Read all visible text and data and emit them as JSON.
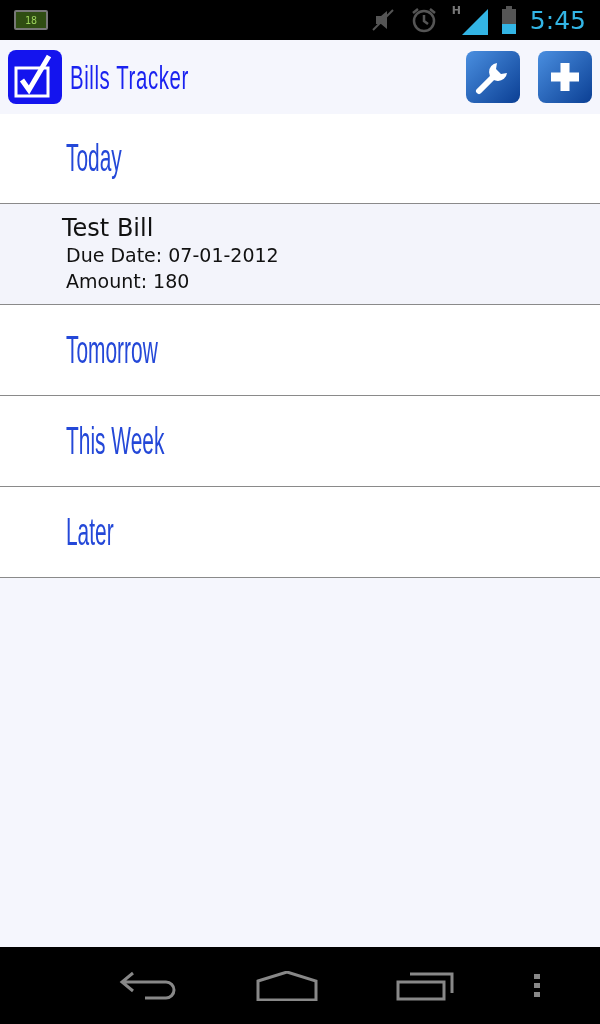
{
  "status_bar": {
    "battery_level_text": "18",
    "network_type": "H",
    "time": "5:45"
  },
  "app_bar": {
    "title": "Bills Tracker"
  },
  "list": [
    {
      "kind": "header",
      "label": "Today"
    },
    {
      "kind": "bill",
      "name": "Test Bill",
      "due_date": "Due Date: 07-01-2012",
      "amount": "Amount: 180"
    },
    {
      "kind": "header",
      "label": "Tomorrow"
    },
    {
      "kind": "header",
      "label": "This Week"
    },
    {
      "kind": "header",
      "label": "Later"
    }
  ]
}
